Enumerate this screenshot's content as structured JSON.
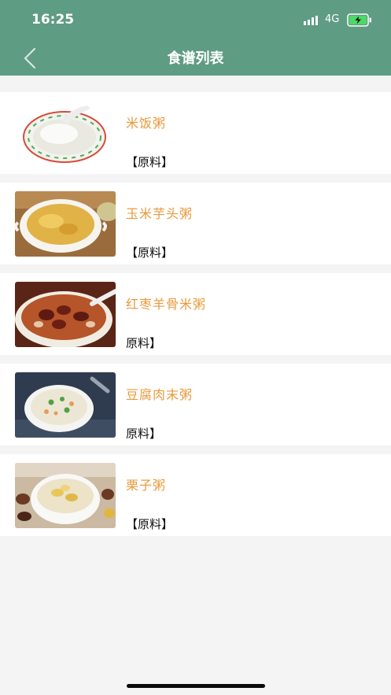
{
  "status_bar": {
    "time": "16:25",
    "network": "4G"
  },
  "header": {
    "title": "食谱列表"
  },
  "recipes": [
    {
      "name": "米饭粥",
      "ingredients_label": "【原料】",
      "image": "rice-porridge-plate"
    },
    {
      "name": "玉米芋头粥",
      "ingredients_label": "【原料】",
      "image": "corn-taro-porridge-bowl"
    },
    {
      "name": "红枣羊骨米粥",
      "ingredients_label": "原料】",
      "image": "jujube-lamb-bone-porridge-bowl"
    },
    {
      "name": "豆腐肉末粥",
      "ingredients_label": "原料】",
      "image": "tofu-minced-meat-porridge-bowl"
    },
    {
      "name": "栗子粥",
      "ingredients_label": "【原料】",
      "image": "chestnut-porridge-bowl"
    }
  ],
  "colors": {
    "header": "#5f9c84",
    "recipe_name": "#e89a3c",
    "background": "#f4f4f4",
    "card": "#ffffff"
  },
  "icons": [
    "signal-icon",
    "battery-charging-icon",
    "back-chevron-icon"
  ]
}
